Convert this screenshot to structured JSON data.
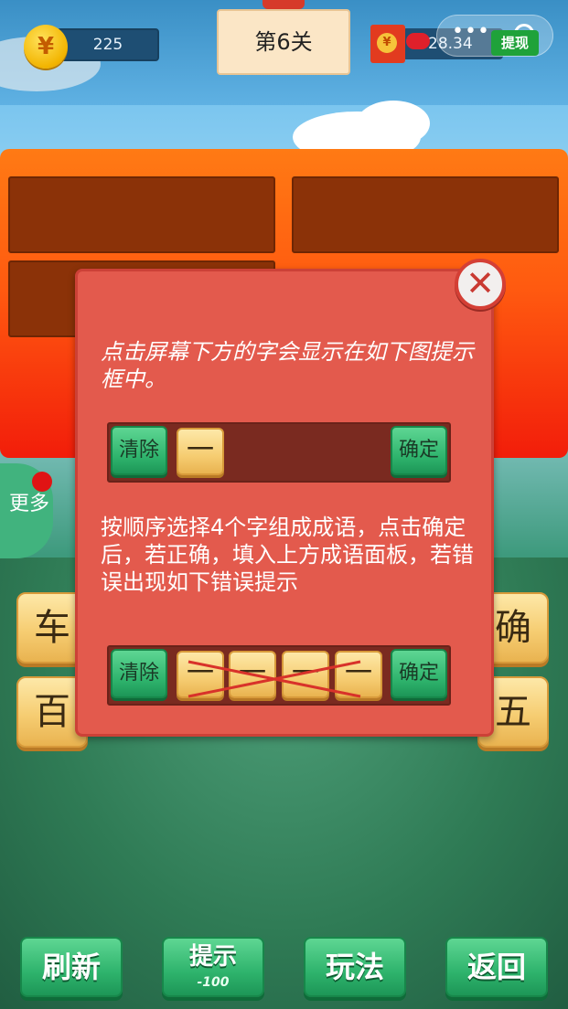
{
  "top": {
    "coin_symbol": "¥",
    "coins": "225",
    "level": "第6关",
    "money": "28.34",
    "withdraw": "提现"
  },
  "side": {
    "more": "更多"
  },
  "tiles": [
    "车",
    "确",
    "百",
    "五"
  ],
  "bottom": {
    "refresh": "刷新",
    "hint": "提示",
    "hint_cost": "-100",
    "rules": "玩法",
    "back": "返回"
  },
  "dialog": {
    "close": "✕",
    "text1": "点击屏幕下方的字会显示在如下图提示框中。",
    "text2": "按顺序选择4个字组成成语，点击确定后，若正确，填入上方成语面板，若错误出现如下错误提示",
    "clear": "清除",
    "confirm": "确定",
    "placeholder": "一"
  },
  "colors": {
    "board": "#ff5a10",
    "dialog": "#e35a4d",
    "green_button": "#2eb36c",
    "tile": "#f6cd72"
  }
}
